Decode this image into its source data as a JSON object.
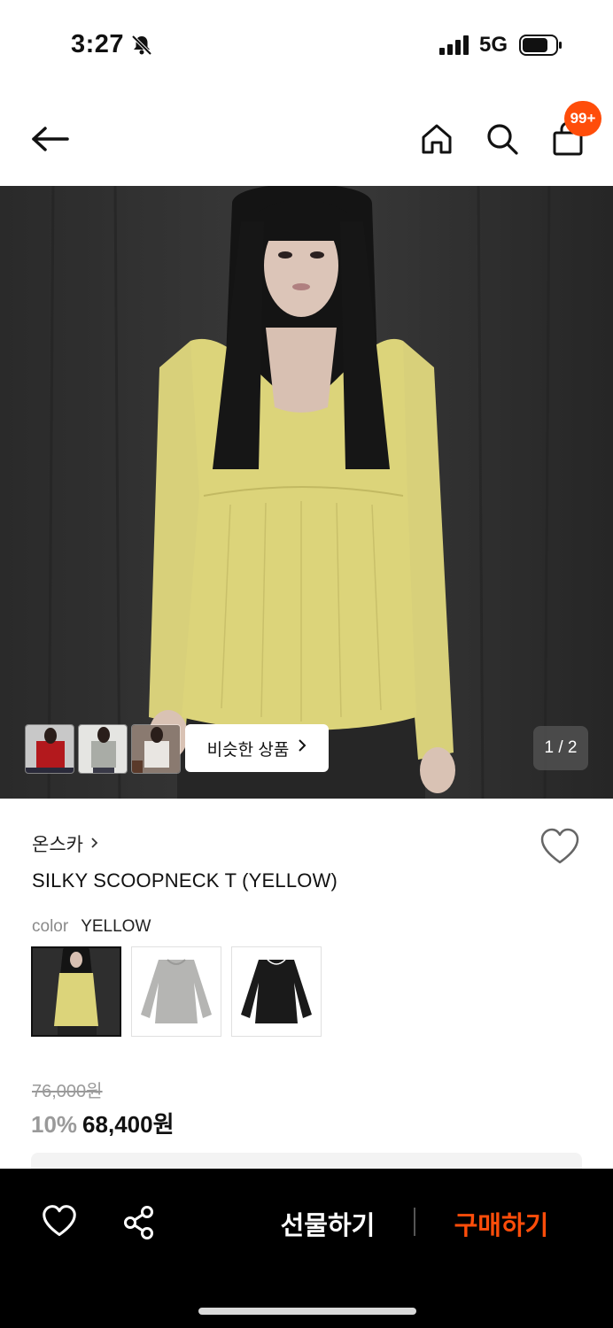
{
  "status_bar": {
    "time": "3:27",
    "network": "5G"
  },
  "nav": {
    "cart_badge": "99+"
  },
  "gallery": {
    "similar_label": "비슷한 상품",
    "pager": "1 / 2",
    "thumbnail_colors": [
      "#b3191d",
      "#a9aca6",
      "#e9e6e2"
    ]
  },
  "product": {
    "brand": "온스카",
    "name": "SILKY SCOOPNECK T (YELLOW)",
    "color_label": "color",
    "color_value": "YELLOW",
    "swatches": [
      "yellow",
      "gray",
      "black"
    ],
    "original_price": "76,000원",
    "discount": "10%",
    "price": "68,400원"
  },
  "bottom_bar": {
    "gift_label": "선물하기",
    "buy_label": "구매하기"
  },
  "colors": {
    "accent": "#ff4d0a",
    "top_yellow": "#dcd47a"
  }
}
